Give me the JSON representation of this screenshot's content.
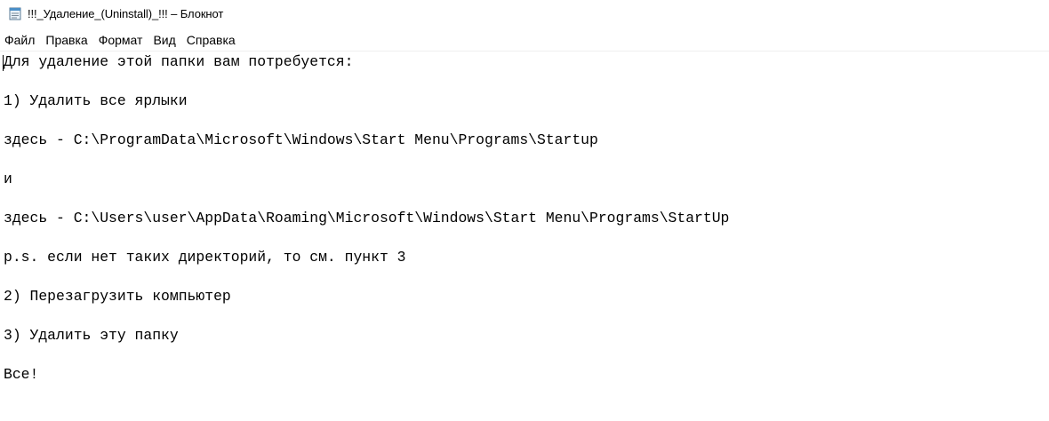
{
  "window": {
    "title": "!!!_Удаление_(Uninstall)_!!! – Блокнот",
    "icon": "notepad-icon"
  },
  "menu": {
    "items": [
      "Файл",
      "Правка",
      "Формат",
      "Вид",
      "Справка"
    ]
  },
  "editor": {
    "lines": [
      "Для удаление этой папки вам потребуется:",
      "1) Удалить все ярлыки",
      "здесь - C:\\ProgramData\\Microsoft\\Windows\\Start Menu\\Programs\\Startup",
      "и",
      "здесь - C:\\Users\\user\\AppData\\Roaming\\Microsoft\\Windows\\Start Menu\\Programs\\StartUp",
      "p.s. если нет таких директорий, то см. пункт 3",
      "2) Перезагрузить компьютер",
      "3) Удалить эту папку",
      "Все!"
    ]
  }
}
